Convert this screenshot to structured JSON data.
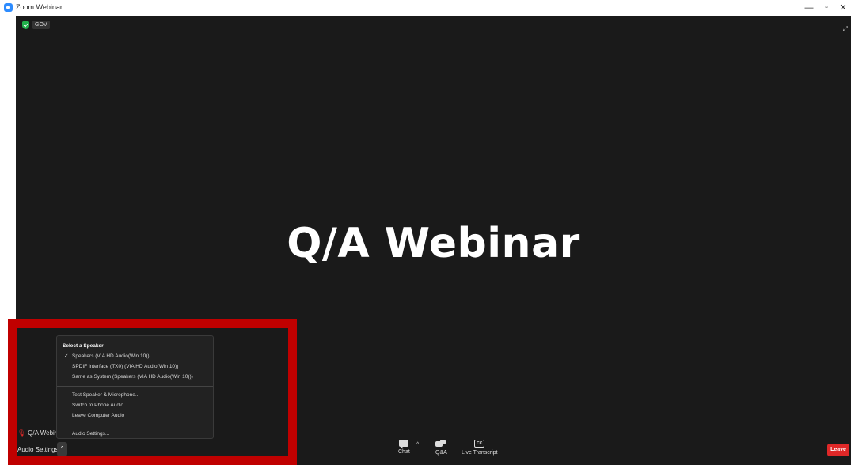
{
  "window": {
    "title": "Zoom Webinar",
    "icon": "zoom-camera-icon",
    "controls": {
      "minimize": "—",
      "maximize": "▫",
      "close": "✕"
    }
  },
  "stage": {
    "security_badge": "GOV",
    "heading": "Q/A Webinar",
    "self_view_label": "Q/A Webina",
    "corner_glyph": "⤢"
  },
  "toolbar": {
    "audio_settings_label": "Audio Settings",
    "audio_caret": "^",
    "chat_caret": "^",
    "chat_label": "Chat",
    "qa_label": "Q&A",
    "cc_text": "CC",
    "live_transcript_label": "Live Transcript",
    "leave_label": "Leave"
  },
  "speaker_menu": {
    "heading": "Select a Speaker",
    "check_glyph": "✓",
    "speakers": [
      "Speakers (VIA HD Audio(Win 10))",
      "SPDIF Interface (TX0) (VIA HD Audio(Win 10))",
      "Same as System (Speakers (VIA HD Audio(Win 10)))"
    ],
    "actions": [
      "Test Speaker & Microphone...",
      "Switch to Phone Audio...",
      "Leave Computer Audio"
    ],
    "settings": "Audio Settings..."
  },
  "colors": {
    "stage_bg": "#1a1a1a",
    "highlight": "#c00000",
    "leave": "#e02828",
    "shield": "#22b14c",
    "zoom_blue": "#2d8cff"
  }
}
